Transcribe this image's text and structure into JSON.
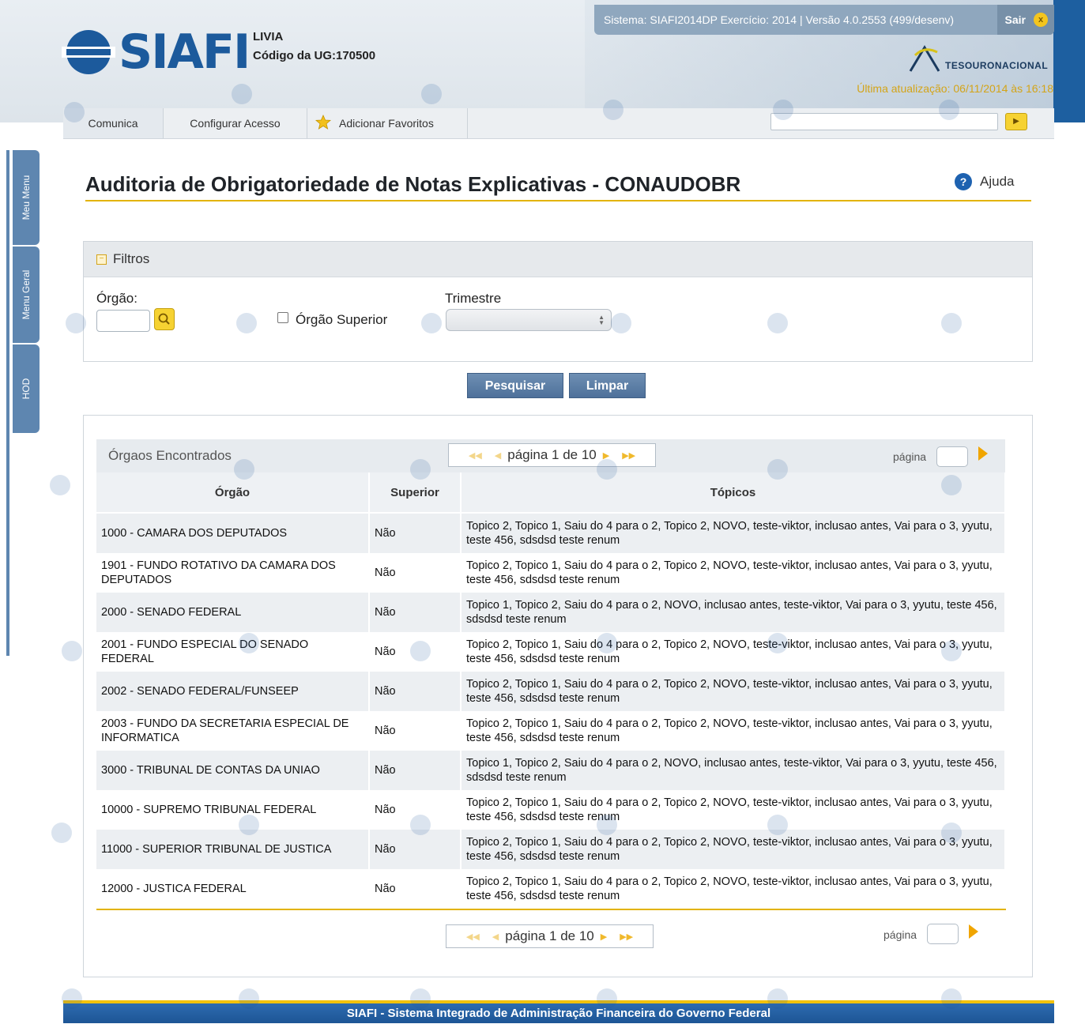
{
  "header": {
    "logo_text": "SIAFI",
    "user_name": "LIVIA",
    "ug_label": "Código da UG:",
    "ug_code": "170500",
    "system_info": "Sistema: SIAFI2014DP Exercício: 2014 | Versão 4.0.2553 (499/desenv)",
    "sair_label": "Sair",
    "sair_icon": "x",
    "tesouro_label": "TESOURONACIONAL",
    "last_update": "Última atualização: 06/11/2014 às 16:18"
  },
  "menu": {
    "comunica": "Comunica",
    "configurar": "Configurar Acesso",
    "favoritos": "Adicionar Favoritos",
    "search_value": "",
    "go_icon": "▶"
  },
  "side_tabs": {
    "meu_menu": "Meu Menu",
    "menu_geral": "Menu Geral",
    "hod": "HOD"
  },
  "page": {
    "title": "Auditoria de Obrigatoriedade de Notas Explicativas - CONAUDOBR",
    "help_label": "Ajuda",
    "help_icon": "?"
  },
  "filters": {
    "section_label": "Filtros",
    "toggle_icon": "−",
    "orgao_label": "Órgão:",
    "orgao_value": "",
    "orgao_superior_label": "Órgão Superior",
    "trimestre_label": "Trimestre",
    "trimestre_value": ""
  },
  "buttons": {
    "pesquisar": "Pesquisar",
    "limpar": "Limpar"
  },
  "results": {
    "title": "Órgaos Encontrados",
    "pager_text": "página 1 de 10",
    "page_label": "página",
    "columns": [
      "Órgão",
      "Superior",
      "Tópicos"
    ],
    "rows": [
      {
        "orgao": "1000 - CAMARA DOS DEPUTADOS",
        "superior": "Não",
        "topicos": "Topico 2, Topico 1, Saiu do 4 para o 2, Topico 2, NOVO, teste-viktor, inclusao antes, Vai para o 3, yyutu, teste 456, sdsdsd teste renum"
      },
      {
        "orgao": "1901 - FUNDO ROTATIVO DA CAMARA DOS DEPUTADOS",
        "superior": "Não",
        "topicos": "Topico 2, Topico 1, Saiu do 4 para o 2, Topico 2, NOVO, teste-viktor, inclusao antes, Vai para o 3, yyutu, teste 456, sdsdsd teste renum"
      },
      {
        "orgao": "2000 - SENADO FEDERAL",
        "superior": "Não",
        "topicos": "Topico 1, Topico 2, Saiu do 4 para o 2, NOVO, inclusao antes, teste-viktor, Vai para o 3, yyutu, teste 456, sdsdsd teste renum"
      },
      {
        "orgao": "2001 - FUNDO ESPECIAL DO SENADO FEDERAL",
        "superior": "Não",
        "topicos": "Topico 2, Topico 1, Saiu do 4 para o 2, Topico 2, NOVO, teste-viktor, inclusao antes, Vai para o 3, yyutu, teste 456, sdsdsd teste renum"
      },
      {
        "orgao": "2002 - SENADO FEDERAL/FUNSEEP",
        "superior": "Não",
        "topicos": "Topico 2, Topico 1, Saiu do 4 para o 2, Topico 2, NOVO, teste-viktor, inclusao antes, Vai para o 3, yyutu, teste 456, sdsdsd teste renum"
      },
      {
        "orgao": "2003 - FUNDO DA SECRETARIA ESPECIAL DE INFORMATICA",
        "superior": "Não",
        "topicos": "Topico 2, Topico 1, Saiu do 4 para o 2, Topico 2, NOVO, teste-viktor, inclusao antes, Vai para o 3, yyutu, teste 456, sdsdsd teste renum"
      },
      {
        "orgao": "3000 - TRIBUNAL DE CONTAS DA UNIAO",
        "superior": "Não",
        "topicos": "Topico 1, Topico 2, Saiu do 4 para o 2, NOVO, inclusao antes, teste-viktor, Vai para o 3, yyutu, teste 456, sdsdsd teste renum"
      },
      {
        "orgao": "10000 - SUPREMO TRIBUNAL FEDERAL",
        "superior": "Não",
        "topicos": "Topico 2, Topico 1, Saiu do 4 para o 2, Topico 2, NOVO, teste-viktor, inclusao antes, Vai para o 3, yyutu, teste 456, sdsdsd teste renum"
      },
      {
        "orgao": "11000 - SUPERIOR TRIBUNAL DE JUSTICA",
        "superior": "Não",
        "topicos": "Topico 2, Topico 1, Saiu do 4 para o 2, Topico 2, NOVO, teste-viktor, inclusao antes, Vai para o 3, yyutu, teste 456, sdsdsd teste renum"
      },
      {
        "orgao": "12000 - JUSTICA FEDERAL",
        "superior": "Não",
        "topicos": "Topico 2, Topico 1, Saiu do 4 para o 2, Topico 2, NOVO, teste-viktor, inclusao antes, Vai para o 3, yyutu, teste 456, sdsdsd teste renum"
      }
    ]
  },
  "footer": {
    "text": "SIAFI - Sistema Integrado de Administração Financeira do Governo Federal"
  },
  "colors": {
    "brand_blue": "#1c5a9c",
    "accent_gold": "#e3b300",
    "button_blue": "#5577a0",
    "footer_blue": "#1d5595"
  }
}
